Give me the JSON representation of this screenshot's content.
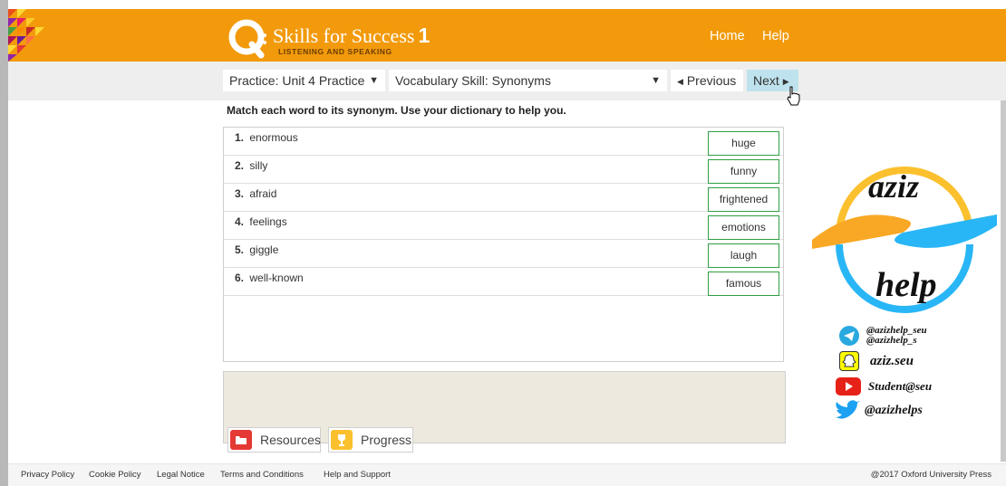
{
  "header": {
    "app_title": "Skills for Success",
    "app_level": "1",
    "app_subtitle": "LISTENING AND SPEAKING",
    "nav": {
      "home": "Home",
      "help": "Help"
    },
    "color": "#f29a0b"
  },
  "navbar": {
    "practice_select": "Practice: Unit 4 Practice",
    "skill_select": "Vocabulary Skill: Synonyms",
    "previous_label": "Previous",
    "next_label": "Next"
  },
  "exercise": {
    "instructions": "Match each word to its synonym. Use your dictionary to help you.",
    "items": [
      {
        "number": "1.",
        "word": "enormous",
        "answer": "huge"
      },
      {
        "number": "2.",
        "word": "silly",
        "answer": "funny"
      },
      {
        "number": "3.",
        "word": "afraid",
        "answer": "frightened"
      },
      {
        "number": "4.",
        "word": "feelings",
        "answer": "emotions"
      },
      {
        "number": "5.",
        "word": "giggle",
        "answer": "laugh"
      },
      {
        "number": "6.",
        "word": "well-known",
        "answer": "famous"
      }
    ],
    "answer_border_color": "#2f9e44"
  },
  "tools": {
    "resources_label": "Resources",
    "progress_label": "Progress"
  },
  "footer": {
    "links": [
      "Privacy Policy",
      "Cookie Policy",
      "Legal Notice",
      "Terms and Conditions",
      "Help and Support"
    ],
    "copyright": "@2017 Oxford University Press"
  },
  "watermark": {
    "word_top": "aziz",
    "word_bottom": "help",
    "telegram_1": "@azizhelp_seu",
    "telegram_2": "@azizhelp_s",
    "snapchat": "aziz.seu",
    "youtube": "Student@seu",
    "twitter": "@azizhelps"
  }
}
